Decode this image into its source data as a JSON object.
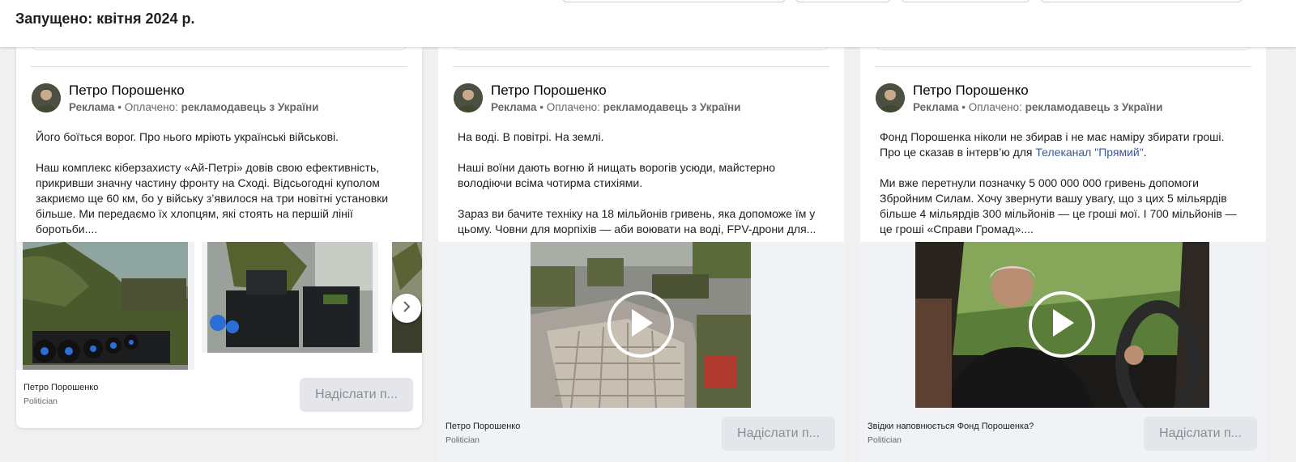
{
  "header": {
    "launched": "Запущено: квітня 2024 р."
  },
  "ads": [
    {
      "page_name": "Петро Порошенко",
      "meta_label": "Реклама",
      "meta_paid": "• Оплачено:",
      "meta_payer": "рекламодавець з України",
      "text": [
        "Його боїться ворог. Про нього мріють українські військові.",
        "Наш комплекс кіберзахисту «Ай-Петрі» довів свою ефективність, прикривши значну частину фронту на Сході. Відсьогодні куполом закриємо ще 60 км, бо у війську з’явилося на три новітні установки більше. Ми передаємо їх хлопцям, які стоять на першій лінії боротьби...."
      ],
      "footer_name": "Петро Порошенко",
      "footer_category": "Politician",
      "cta_label": "Надіслати п...",
      "media": "carousel",
      "nav_icon": "chevron-right-icon"
    },
    {
      "page_name": "Петро Порошенко",
      "meta_label": "Реклама",
      "meta_paid": "• Оплачено:",
      "meta_payer": "рекламодавець з України",
      "text": [
        "На воді. В повітрі. На землі.",
        "Наші воїни дають вогню й нищать ворогів усюди, майстерно володіючи всіма чотирма стихіями.",
        "Зараз ви бачите техніку на 18 мільйонів гривень, яка допоможе їм у цьому. Човни для морпіхів — аби воювати на воді, FPV-дрони для..."
      ],
      "footer_name": "Петро Порошенко",
      "footer_category": "Politician",
      "cta_label": "Надіслати п...",
      "media": "video",
      "play_icon": "play-icon"
    },
    {
      "page_name": "Петро Порошенко",
      "meta_label": "Реклама",
      "meta_paid": "• Оплачено:",
      "meta_payer": "рекламодавець з України",
      "text_1_prefix": "Фонд Порошенка ніколи не збирав і не має наміру збирати гроші. Про це сказав в інтерв’ю для ",
      "text_1_link": "Телеканал \"Прямий\"",
      "text_1_suffix": ".",
      "text_2": "Ми вже перетнули позначку 5 000 000 000 гривень допомоги Збройним Силам. Хочу звернути вашу увагу, що з цих 5 мільярдів більше 4 мільярдів 300 мільйонів — це гроші мої. І 700 мільйонів — це гроші «Справи Громад»....",
      "footer_name": "Звідки наповнюється Фонд Порошенка?",
      "footer_category": "Politician",
      "cta_label": "Надіслати п...",
      "media": "video",
      "play_icon": "play-icon"
    }
  ],
  "colors": {
    "background": "#f0f0f0",
    "link": "#385898",
    "cta_bg": "#e4e6eb",
    "cta_text": "#8a8d91"
  }
}
